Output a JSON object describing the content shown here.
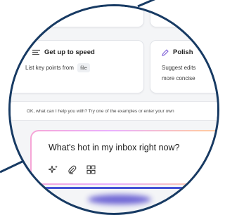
{
  "suggestions": [
    {
      "title": "Get up to speed",
      "icon": "list-icon",
      "body_text": "List key points from",
      "chip": "file"
    },
    {
      "title": "Polish",
      "icon": "pen-icon",
      "body_line1": "Suggest edits",
      "body_line2": "more concise"
    }
  ],
  "hint": "OK, what can I help you with? Try one of the examples or enter your own",
  "composer": {
    "prompt": "What's hot in my inbox right now?",
    "tools": [
      "sparkle-icon",
      "attach-icon",
      "grid-add-icon"
    ]
  },
  "colors": {
    "border": "#173a63",
    "accent": "#4653d6",
    "gradient": [
      "#f6a6d6",
      "#e9b0ff",
      "#ffc9a6"
    ]
  }
}
